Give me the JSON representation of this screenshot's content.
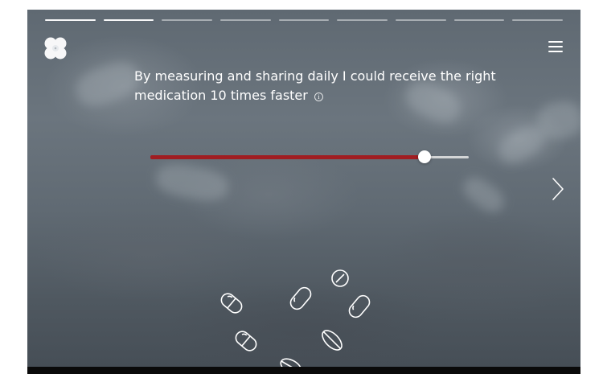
{
  "statement": {
    "line1": "By measuring and sharing daily I could receive the right",
    "line2": "medication 10 times faster"
  },
  "icons": {
    "logo": "heart-clover-logo-icon",
    "menu": "hamburger-menu-icon",
    "info": "info-icon",
    "next": "chevron-right-icon",
    "pill": "pill-icon"
  },
  "progress": {
    "total_segments": 9,
    "completed_segments": 2
  },
  "slider": {
    "value_fraction": 0.86
  },
  "colors": {
    "accent": "#a01d22",
    "text": "#ffffff",
    "bottom_bar": "#0a0a0a"
  }
}
